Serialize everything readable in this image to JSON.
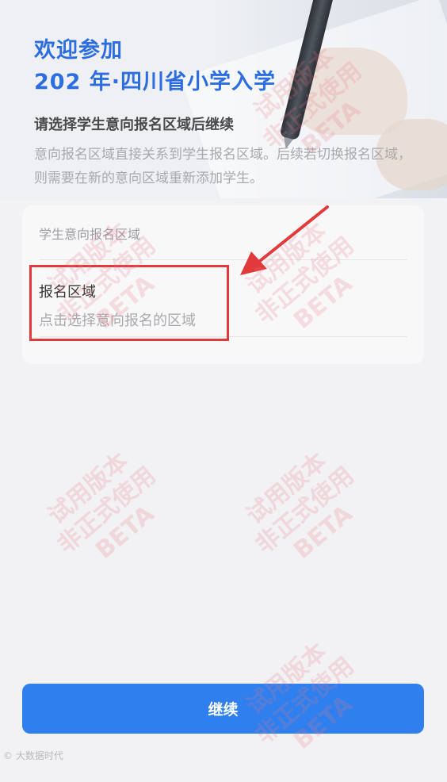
{
  "header": {
    "title_line1": "欢迎参加",
    "title_line2": "202  年·四川省小学入学"
  },
  "intro": {
    "subtitle": "请选择学生意向报名区域后继续",
    "description": "意向报名区域直接关系到学生报名区域。后续若切换报名区域，则需要在新的意向区域重新添加学生。"
  },
  "form": {
    "section_label": "学生意向报名区域",
    "field_label": "报名区域",
    "field_placeholder": "点击选择意向报名的区域"
  },
  "footer": {
    "continue_label": "继续"
  },
  "watermark": {
    "line1": "试用版本",
    "line2": "非正式使用",
    "line3": "BETA"
  },
  "credit": "© 大数据时代",
  "colors": {
    "accent": "#2c6de0",
    "button": "#2f80ee",
    "highlight": "#e23a3a"
  }
}
